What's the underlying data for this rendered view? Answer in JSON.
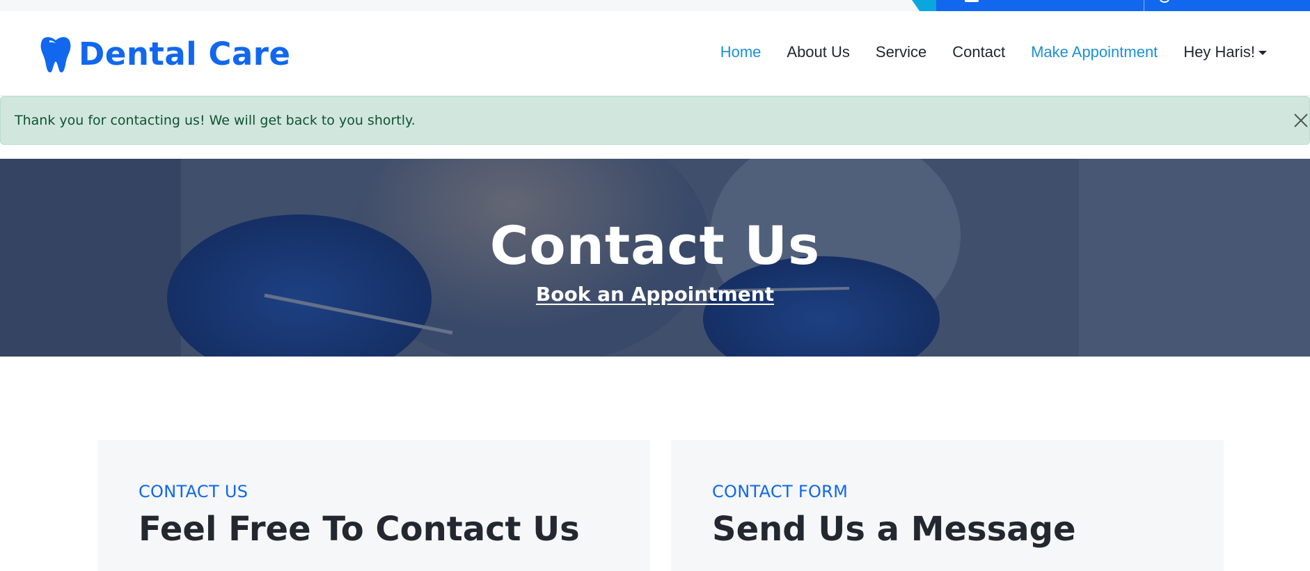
{
  "brand": {
    "name": "Dental Care",
    "icon": "tooth-icon",
    "color": "#1167ee"
  },
  "nav": {
    "items": [
      {
        "label": "Home",
        "state": "active"
      },
      {
        "label": "About Us"
      },
      {
        "label": "Service"
      },
      {
        "label": "Contact"
      },
      {
        "label": "Make Appointment",
        "state": "highlight"
      }
    ],
    "user_menu": {
      "label": "Hey Haris!",
      "icon": "caret-down-icon"
    }
  },
  "alert": {
    "message": "Thank you for contacting us! We will get back to you shortly.",
    "type": "success",
    "close_icon": "close-icon"
  },
  "hero": {
    "title": "Contact Us",
    "link_label": "Book an Appointment"
  },
  "sections": {
    "contact_info": {
      "eyebrow": "CONTACT US",
      "heading": "Feel Free To Contact Us"
    },
    "contact_form": {
      "eyebrow": "CONTACT FORM",
      "heading": "Send Us a Message"
    }
  },
  "colors": {
    "primary": "#1167ee",
    "link_active": "#1b8fd8",
    "alert_bg": "#d1e7dd",
    "alert_text": "#0f5132",
    "hero_overlay": "#112448"
  }
}
